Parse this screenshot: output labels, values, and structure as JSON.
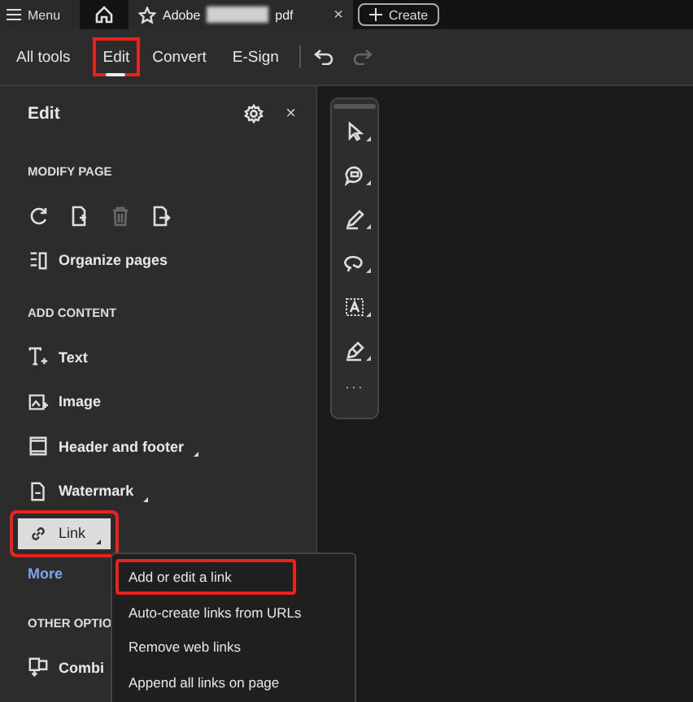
{
  "top_bar": {
    "menu_label": "Menu",
    "tab": {
      "title_start": "Adobe",
      "title_end": "pdf",
      "redacted": true,
      "close": "×"
    },
    "create_label": "Create"
  },
  "toolbar": {
    "tabs": [
      {
        "label": "All tools",
        "selected": false,
        "highlighted": false
      },
      {
        "label": "Edit",
        "selected": true,
        "highlighted": true
      },
      {
        "label": "Convert",
        "selected": false,
        "highlighted": false
      },
      {
        "label": "E-Sign",
        "selected": false,
        "highlighted": false
      }
    ],
    "undo": {
      "disabled": false
    },
    "redo": {
      "disabled": true
    }
  },
  "panel": {
    "title": "Edit",
    "close": "×",
    "sections": [
      {
        "heading": "MODIFY PAGE",
        "items": [
          {
            "kind": "icon-row",
            "buttons": [
              {
                "disabled": false
              },
              {
                "disabled": false
              },
              {
                "disabled": true
              },
              {
                "disabled": false
              }
            ]
          },
          {
            "kind": "tool",
            "label": "Organize pages",
            "submenu": false,
            "selected": false,
            "highlighted": false
          }
        ]
      },
      {
        "heading": "ADD CONTENT",
        "items": [
          {
            "kind": "tool",
            "label": "Text",
            "submenu": false,
            "selected": false,
            "highlighted": false
          },
          {
            "kind": "tool",
            "label": "Image",
            "submenu": false,
            "selected": false,
            "highlighted": false
          },
          {
            "kind": "tool",
            "label": "Header and footer",
            "submenu": true,
            "selected": false,
            "highlighted": false
          },
          {
            "kind": "tool",
            "label": "Watermark",
            "submenu": true,
            "selected": false,
            "highlighted": false
          },
          {
            "kind": "tool",
            "label": "Link",
            "submenu": true,
            "selected": true,
            "highlighted": true
          },
          {
            "kind": "link",
            "label": "More"
          }
        ]
      },
      {
        "heading": "OTHER OPTIO",
        "items": [
          {
            "kind": "tool",
            "label": "Combi",
            "submenu": false,
            "selected": false,
            "highlighted": false
          }
        ]
      }
    ]
  },
  "tool_strip": {
    "more": "···"
  },
  "popup_menu": {
    "items": [
      {
        "label": "Add or edit a link",
        "highlighted": true
      },
      {
        "label": "Auto-create links from URLs",
        "highlighted": false
      },
      {
        "label": "Remove web links",
        "highlighted": false
      },
      {
        "label": "Append all links on page",
        "highlighted": false
      }
    ]
  }
}
